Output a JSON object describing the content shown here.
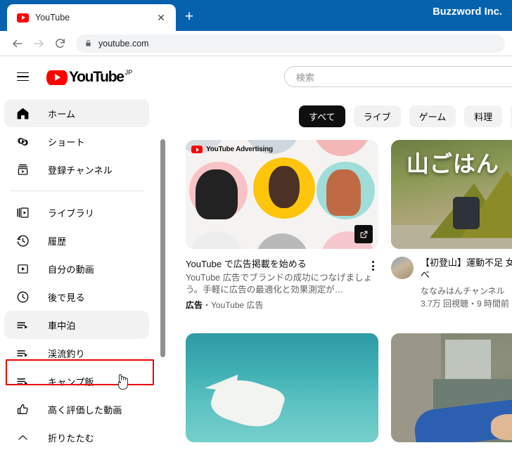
{
  "browser": {
    "tab": {
      "title": "YouTube",
      "favicon": "youtube-favicon",
      "close_label": "✕"
    },
    "new_tab_label": "+",
    "window_brand": "Buzzword Inc.",
    "toolbar": {
      "back_label": "←",
      "forward_label": "→",
      "reload_label": "⟳",
      "lock_icon": "lock-icon",
      "url": "youtube.com"
    },
    "colors": {
      "titlebar": "#0762ad",
      "tab_active": "#ffffff"
    }
  },
  "youtube": {
    "menu_label": "menu-icon",
    "logo": {
      "wordmark": "YouTube",
      "country_code": "JP"
    },
    "search": {
      "placeholder": "検索",
      "value": ""
    },
    "sidebar": {
      "groups": [
        {
          "items": [
            {
              "label": "ホーム",
              "icon": "home-icon",
              "active": true
            },
            {
              "label": "ショート",
              "icon": "shorts-icon",
              "active": false
            },
            {
              "label": "登録チャンネル",
              "icon": "subscriptions-icon",
              "active": false
            }
          ]
        },
        {
          "items": [
            {
              "label": "ライブラリ",
              "icon": "library-icon",
              "active": false
            },
            {
              "label": "履歴",
              "icon": "history-icon",
              "active": false
            },
            {
              "label": "自分の動画",
              "icon": "your-videos-icon",
              "active": false
            },
            {
              "label": "後で見る",
              "icon": "watch-later-icon",
              "active": false
            },
            {
              "label": "車中泊",
              "icon": "playlist-icon",
              "active": true,
              "highlighted": true
            },
            {
              "label": "渓流釣り",
              "icon": "playlist-icon",
              "active": false
            },
            {
              "label": "キャンプ飯",
              "icon": "playlist-icon",
              "active": false
            },
            {
              "label": "高く評価した動画",
              "icon": "thumbs-up-icon",
              "active": false
            },
            {
              "label": "折りたたむ",
              "icon": "chevron-up-icon",
              "active": false
            }
          ]
        }
      ],
      "highlight_color": "#ee0000"
    },
    "chips": [
      {
        "label": "すべて",
        "selected": true
      },
      {
        "label": "ライブ",
        "selected": false
      },
      {
        "label": "ゲーム",
        "selected": false
      },
      {
        "label": "料理",
        "selected": false
      },
      {
        "label": "",
        "selected": false
      }
    ],
    "videos": [
      {
        "kind": "ad",
        "thumbnail": "youtube-advertising-people-collage",
        "thumb_badge": "YouTube Advertising",
        "title": "YouTube で広告掲載を始める",
        "description": "YouTube 広告でブランドの成功につなげましょう。手軽に広告の最適化と効果測定が…",
        "byline_tag": "広告",
        "byline_rest": "・YouTube 広告",
        "overlay_icon": "external-link-icon",
        "menu_icon": "kebab-menu-icon"
      },
      {
        "kind": "video",
        "thumbnail": "mountain-camping-tent",
        "thumb_text": "山ごはん",
        "title": "【初登山】運動不足 女　疲れ切って食べ",
        "channel": "ななみはんチャンネル",
        "stats": "3.7万 回視聴・9 時間前",
        "avatar": "channel-avatar"
      },
      {
        "kind": "video",
        "thumbnail": "underwater-white-fish",
        "title": "",
        "channel": "",
        "stats": ""
      },
      {
        "kind": "video",
        "thumbnail": "river-dam-trout-fishing",
        "title": "",
        "channel": "",
        "stats": ""
      }
    ]
  }
}
